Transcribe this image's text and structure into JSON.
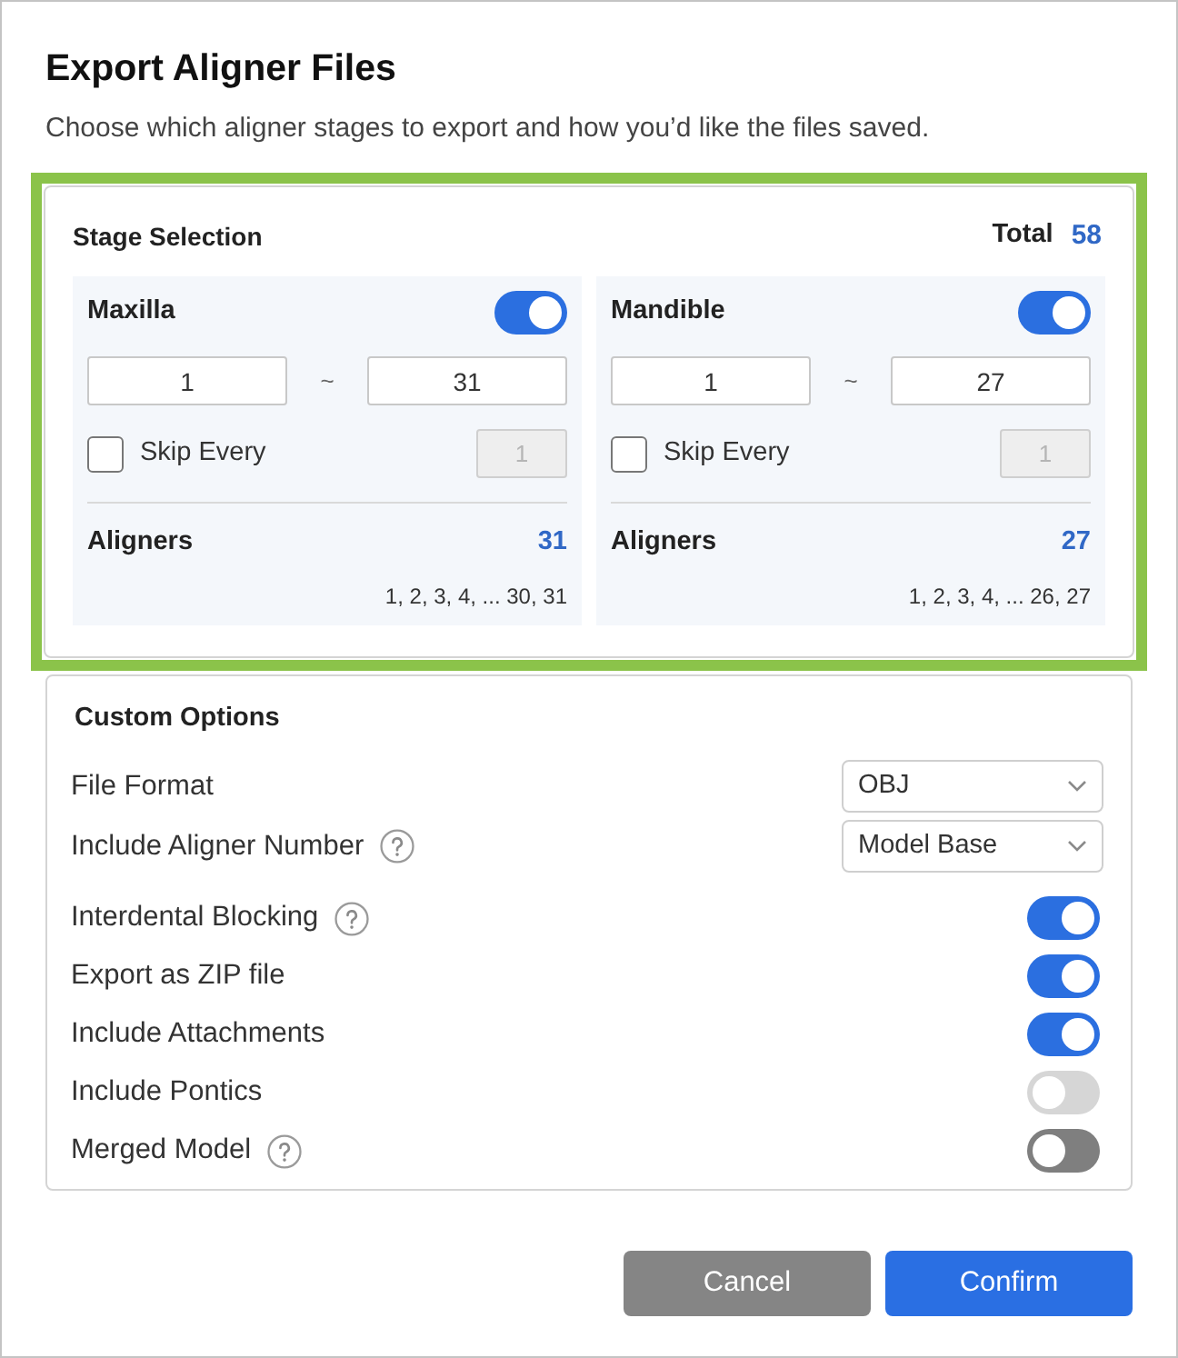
{
  "dialog": {
    "title": "Export Aligner Files",
    "subtitle": "Choose which aligner stages to export and how you’d like the files saved."
  },
  "stage_selection": {
    "title": "Stage Selection",
    "highlighted": true,
    "total_label": "Total",
    "total_value": "58",
    "jaws": [
      {
        "name": "Maxilla",
        "on": true,
        "from": "1",
        "separator": "~",
        "to": "31",
        "skip_checked": false,
        "skip_label": "Skip Every",
        "skip_value": "1",
        "skip_disabled": true,
        "aligners_label": "Aligners",
        "aligners_count": "31",
        "aligners_list": "1, 2, 3, 4, ... 30, 31"
      },
      {
        "name": "Mandible",
        "on": true,
        "from": "1",
        "separator": "~",
        "to": "27",
        "skip_checked": false,
        "skip_label": "Skip Every",
        "skip_value": "1",
        "skip_disabled": true,
        "aligners_label": "Aligners",
        "aligners_count": "27",
        "aligners_list": "1, 2, 3, 4, ... 26, 27"
      }
    ]
  },
  "custom_options": {
    "title": "Custom Options",
    "options": [
      {
        "kind": "select",
        "label": "File Format",
        "help": false,
        "value": "OBJ"
      },
      {
        "kind": "select",
        "label": "Include Aligner Number",
        "help": true,
        "value": "Model Base"
      },
      {
        "kind": "toggle",
        "label": "Interdental Blocking",
        "help": true,
        "on": true,
        "disabled": false
      },
      {
        "kind": "toggle",
        "label": "Export as ZIP file",
        "help": false,
        "on": true,
        "disabled": false
      },
      {
        "kind": "toggle",
        "label": "Include Attachments",
        "help": false,
        "on": true,
        "disabled": false
      },
      {
        "kind": "toggle",
        "label": "Include Pontics",
        "help": false,
        "on": false,
        "disabled": true
      },
      {
        "kind": "toggle",
        "label": "Merged Model",
        "help": true,
        "on": false,
        "disabled": false
      }
    ]
  },
  "buttons": [
    {
      "label": "Cancel",
      "kind": "secondary"
    },
    {
      "label": "Confirm",
      "kind": "primary"
    }
  ]
}
